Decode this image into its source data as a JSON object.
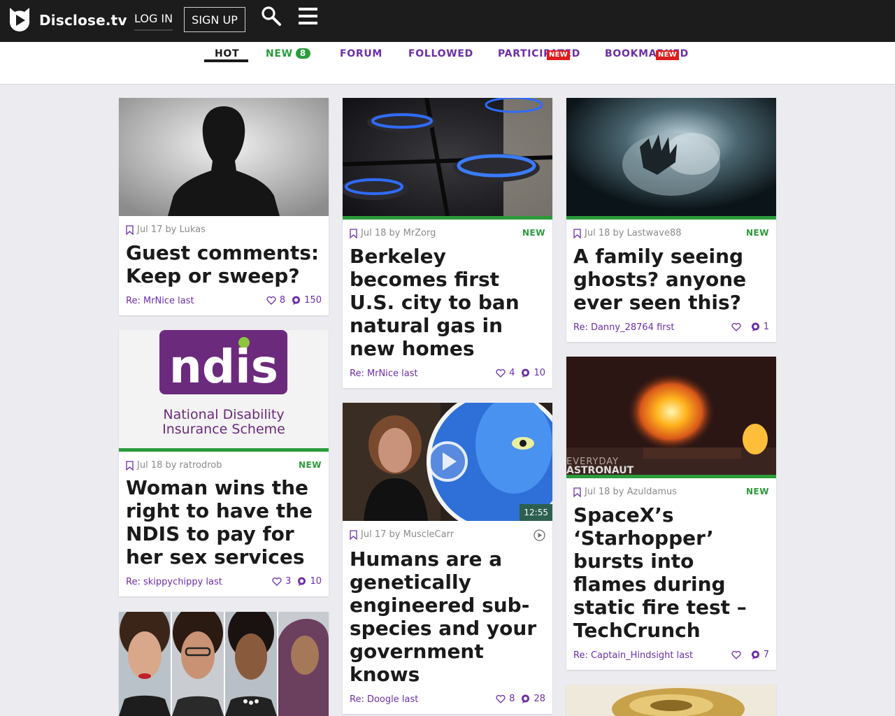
{
  "header": {
    "brand": "Disclose.tv",
    "login_label": "LOG IN",
    "signup_label": "SIGN UP",
    "icons": [
      "logo-icon",
      "search-icon",
      "menu-icon"
    ]
  },
  "tabs": [
    {
      "label": "HOT",
      "active": true
    },
    {
      "label": "NEW",
      "count": "8"
    },
    {
      "label": "FORUM"
    },
    {
      "label": "FOLLOWED"
    },
    {
      "label": "PARTICIPATED",
      "badge": "NEW"
    },
    {
      "label": "BOOKMARKED",
      "badge": "NEW"
    }
  ],
  "colors": {
    "topbar": "#1c1c1c",
    "accent_purple": "#6b2fa8",
    "new_green": "#2b9b3b",
    "badge_red": "#e01b1b",
    "page_bg": "#ececf0"
  },
  "cards": [
    {
      "meta": "Jul 17 by Lukas",
      "new": "",
      "title": "Guest comments: Keep or sweep?",
      "reply": "Re: MrNice last",
      "likes": "8",
      "comments": "150"
    },
    {
      "meta": "Jul 18 by MrZorg",
      "new": "NEW",
      "title": "Berkeley becomes first U.S. city to ban natural gas in new homes",
      "reply": "Re: MrNice last",
      "likes": "4",
      "comments": "10"
    },
    {
      "meta": "Jul 18 by Lastwave88",
      "new": "NEW",
      "title": "A family seeing ghosts? anyone ever seen this?",
      "reply": "Re: Danny_28764 first",
      "likes": "",
      "comments": "1"
    },
    {
      "meta": "Jul 18 by ratrodrob",
      "new": "NEW",
      "title": "Woman wins the right to have the NDIS to pay for her sex services",
      "reply": "Re: skippychippy last",
      "likes": "3",
      "comments": "10",
      "image_text": {
        "logo": "ndis",
        "line1": "National Disability",
        "line2": "Insurance Scheme"
      }
    },
    {
      "meta": "Jul 17 by MuscleCarr",
      "new": "",
      "title": "Humans are a genetically engineered sub-species and your government knows",
      "reply": "Re: Doogle last",
      "likes": "8",
      "comments": "28",
      "duration": "12:55"
    },
    {
      "meta": "Jul 18 by Azuldamus",
      "new": "NEW",
      "title": "SpaceX’s ‘Starhopper’ bursts into flames during static fire test – TechCrunch",
      "reply": "Re: Captain_Hindsight last",
      "likes": "",
      "comments": "7",
      "image_text": {
        "watermark1": "EVERYDAY",
        "watermark2": "ASTRONAUT"
      }
    }
  ]
}
